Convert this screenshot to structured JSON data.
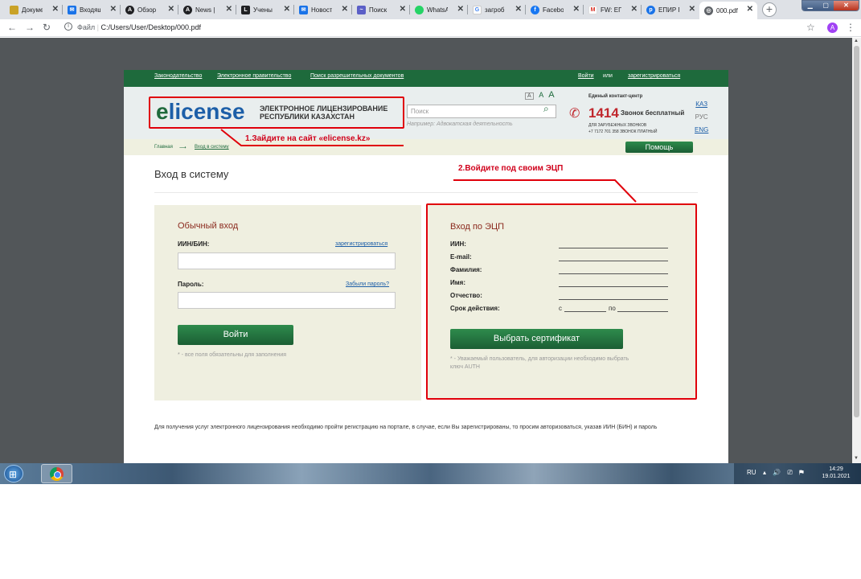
{
  "browser": {
    "tabs": [
      {
        "title": "Докуме",
        "color": "#c9a227"
      },
      {
        "title": "Входящ",
        "color": "#1a73e8"
      },
      {
        "title": "Обзор",
        "color": "#202124"
      },
      {
        "title": "News |",
        "color": "#202124"
      },
      {
        "title": "Учены",
        "color": "#202124"
      },
      {
        "title": "Новост",
        "color": "#1a73e8"
      },
      {
        "title": "Поиск",
        "color": "#5b5fc7"
      },
      {
        "title": "WhatsA",
        "color": "#25d366"
      },
      {
        "title": "загроб",
        "color": "#4285f4"
      },
      {
        "title": "Facebo",
        "color": "#1877f2"
      },
      {
        "title": "FW: ЕП",
        "color": "#d93025"
      },
      {
        "title": "ЕПИР П",
        "color": "#1a73e8"
      },
      {
        "title": "000.pdf",
        "color": "#5f6368"
      }
    ],
    "new_tab_label": "+",
    "address_label": "Файл",
    "address_url": "C:/Users/User/Desktop/000.pdf",
    "avatar_letter": "A"
  },
  "site": {
    "topnav": {
      "links": [
        "Законодательство",
        "Электронное правительство",
        "Поиск разрешительных документов"
      ],
      "login": "Войти",
      "or": "или",
      "register": "зарегистрироваться"
    },
    "logo": {
      "prefix": "e",
      "rest": "license",
      "line1": "ЭЛЕКТРОННОЕ ЛИЦЕНЗИРОВАНИЕ",
      "line2": "РЕСПУБЛИКИ КАЗАХСТАН"
    },
    "search": {
      "placeholder": "Поиск",
      "hint": "Например: Адвокатская деятельность"
    },
    "font_sizes": [
      "A",
      "A",
      "A"
    ],
    "contact": {
      "label": "Единый контакт-центр",
      "number": "1414",
      "free": "Звонок бесплатный",
      "intl_line1": "ДЛЯ ЗАРУБЕЖНЫХ ЗВОНКОВ",
      "intl_line2": "+7 7172 701 358 ЗВОНОК ПЛАТНЫЙ"
    },
    "languages": [
      "КАЗ",
      "РУС",
      "ENG"
    ],
    "breadcrumb": {
      "home": "Главная",
      "arrow": "⟶",
      "current": "Вход в систему"
    },
    "help_button": "Помощь",
    "page_title": "Вход в систему",
    "regular_login": {
      "title": "Обычный вход",
      "iin_label": "ИИН/БИН:",
      "register_link": "зарегистрироваться",
      "password_label": "Пароль:",
      "forgot_link": "Забыли пароль?",
      "login_button": "Войти",
      "note": "* - все поля обязательны для заполнения"
    },
    "eds_login": {
      "title": "Вход по ЭЦП",
      "fields": [
        "ИИН:",
        "E-mail:",
        "Фамилия:",
        "Имя:",
        "Отчество:",
        "Срок действия:"
      ],
      "validity_from": "с",
      "validity_to": "по",
      "select_button": "Выбрать сертификат",
      "note_line1": "* - Уважаемый пользователь, для авторизации необходимо выбрать",
      "note_line2": "ключ AUTH"
    },
    "bottom_text": "Для получения услуг электронного лицензирования необходимо пройти регистрацию на портале, в случае, если Вы зарегистрированы, то просим авторизоваться, указав ИИН (БИН) и пароль"
  },
  "annotations": {
    "step1": "1.Зайдите на сайт «elicense.kz»",
    "step2": "2.Войдите под своим ЭЦП",
    "color": "#e0000b"
  },
  "taskbar": {
    "lang": "RU",
    "time": "14:29",
    "date": "19.01.2021"
  }
}
